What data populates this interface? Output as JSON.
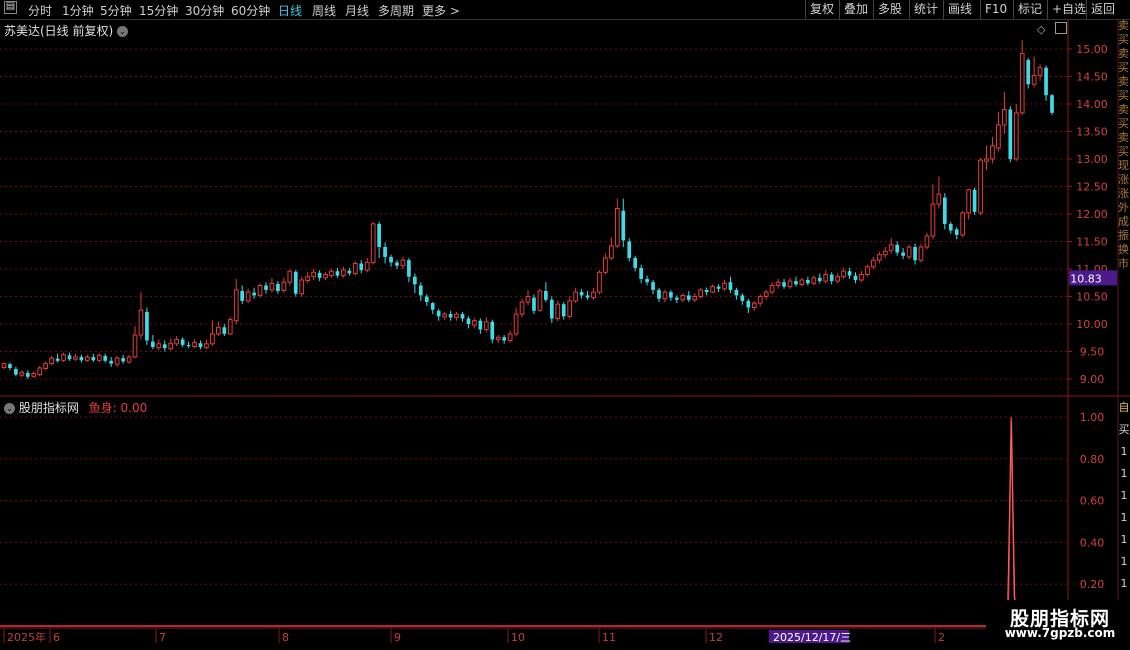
{
  "toolbar": {
    "left_items": [
      "分时",
      "1分钟",
      "5分钟",
      "15分钟",
      "30分钟",
      "60分钟",
      "日线",
      "周线",
      "月线",
      "多周期",
      "更多 >"
    ],
    "active_item": "日线",
    "right_items": [
      "复权",
      "叠加",
      "多股",
      "统计",
      "画线",
      "F10",
      "标记",
      "+自选",
      "返回"
    ]
  },
  "stock": {
    "title": "苏美达(日线 前复权)"
  },
  "price_axis": {
    "ticks": [
      "15.00",
      "14.50",
      "14.00",
      "13.50",
      "13.00",
      "12.50",
      "12.00",
      "11.50",
      "11.00",
      "10.50",
      "10.00",
      "9.50",
      "9.00"
    ],
    "current_label": "10.83"
  },
  "indicator": {
    "title": "股朋指标网",
    "value_label": "鱼身: 0.00",
    "ticks": [
      "1.00",
      "0.80",
      "0.60",
      "0.40",
      "0.20"
    ],
    "edge_marks": [
      "自",
      "买",
      "1",
      "1",
      "1",
      "1",
      "1",
      "1",
      "1",
      "1"
    ]
  },
  "date_axis": {
    "labels": [
      "2025年",
      "6",
      "7",
      "8",
      "9",
      "10",
      "11",
      "12",
      "2025/12/17/三",
      "2"
    ]
  },
  "right_panel_text": "卖买卖买卖买卖买卖买现涨涨外成振换市",
  "watermark": {
    "title": "股朋指标网",
    "url": "www.7gpzb.com"
  },
  "colors": {
    "up": "#e23c3c",
    "down": "#3cdce8",
    "grid": "#6a1010",
    "axis_bg_highlight": "#4b1a8c"
  },
  "chart_data": {
    "type": "candlestick",
    "ylim": [
      8.8,
      15.2
    ],
    "candles": [
      [
        9.21,
        9.28,
        9.3,
        9.18
      ],
      [
        9.27,
        9.2,
        9.3,
        9.16
      ],
      [
        9.18,
        9.08,
        9.22,
        9.05
      ],
      [
        9.07,
        9.12,
        9.16,
        9.03
      ],
      [
        9.11,
        9.04,
        9.16,
        9.0
      ],
      [
        9.05,
        9.1,
        9.14,
        9.02
      ],
      [
        9.08,
        9.2,
        9.24,
        9.05
      ],
      [
        9.19,
        9.28,
        9.32,
        9.16
      ],
      [
        9.28,
        9.38,
        9.42,
        9.25
      ],
      [
        9.37,
        9.33,
        9.46,
        9.3
      ],
      [
        9.34,
        9.44,
        9.48,
        9.31
      ],
      [
        9.43,
        9.36,
        9.48,
        9.33
      ],
      [
        9.36,
        9.4,
        9.46,
        9.33
      ],
      [
        9.4,
        9.34,
        9.44,
        9.3
      ],
      [
        9.34,
        9.4,
        9.44,
        9.31
      ],
      [
        9.4,
        9.34,
        9.46,
        9.31
      ],
      [
        9.34,
        9.43,
        9.47,
        9.31
      ],
      [
        9.42,
        9.33,
        9.46,
        9.3
      ],
      [
        9.33,
        9.28,
        9.4,
        9.22
      ],
      [
        9.27,
        9.38,
        9.42,
        9.22
      ],
      [
        9.38,
        9.32,
        9.44,
        9.28
      ],
      [
        9.31,
        9.4,
        9.44,
        9.28
      ],
      [
        9.4,
        9.8,
        9.96,
        9.38
      ],
      [
        9.8,
        10.25,
        10.58,
        9.72
      ],
      [
        10.22,
        9.7,
        10.3,
        9.62
      ],
      [
        9.68,
        9.58,
        9.8,
        9.54
      ],
      [
        9.57,
        9.64,
        9.72,
        9.52
      ],
      [
        9.63,
        9.56,
        9.7,
        9.5
      ],
      [
        9.55,
        9.65,
        9.74,
        9.52
      ],
      [
        9.64,
        9.72,
        9.78,
        9.6
      ],
      [
        9.72,
        9.62,
        9.76,
        9.58
      ],
      [
        9.62,
        9.6,
        9.68,
        9.56
      ],
      [
        9.59,
        9.66,
        9.72,
        9.56
      ],
      [
        9.65,
        9.58,
        9.7,
        9.54
      ],
      [
        9.57,
        9.64,
        9.72,
        9.54
      ],
      [
        9.64,
        9.82,
        10.06,
        9.6
      ],
      [
        9.82,
        9.94,
        10.05,
        9.78
      ],
      [
        9.94,
        9.82,
        10.0,
        9.78
      ],
      [
        9.82,
        10.08,
        10.12,
        9.8
      ],
      [
        10.06,
        10.62,
        10.82,
        10.0
      ],
      [
        10.6,
        10.42,
        10.7,
        10.36
      ],
      [
        10.42,
        10.58,
        10.64,
        10.38
      ],
      [
        10.57,
        10.52,
        10.66,
        10.46
      ],
      [
        10.52,
        10.7,
        10.74,
        10.48
      ],
      [
        10.7,
        10.62,
        10.76,
        10.55
      ],
      [
        10.62,
        10.74,
        10.84,
        10.58
      ],
      [
        10.73,
        10.6,
        10.78,
        10.55
      ],
      [
        10.61,
        10.76,
        10.84,
        10.57
      ],
      [
        10.76,
        10.96,
        10.99,
        10.7
      ],
      [
        10.95,
        10.55,
        10.98,
        10.5
      ],
      [
        10.55,
        10.8,
        10.86,
        10.5
      ],
      [
        10.79,
        10.86,
        10.94,
        10.74
      ],
      [
        10.86,
        10.94,
        11.0,
        10.8
      ],
      [
        10.93,
        10.84,
        10.98,
        10.78
      ],
      [
        10.84,
        10.9,
        10.94,
        10.8
      ],
      [
        10.88,
        10.96,
        11.0,
        10.84
      ],
      [
        10.96,
        10.88,
        11.02,
        10.84
      ],
      [
        10.88,
        10.98,
        11.04,
        10.84
      ],
      [
        10.97,
        10.92,
        11.02,
        10.88
      ],
      [
        10.92,
        11.1,
        11.14,
        10.88
      ],
      [
        11.1,
        10.98,
        11.16,
        10.92
      ],
      [
        10.98,
        11.12,
        11.2,
        10.94
      ],
      [
        11.12,
        11.82,
        11.86,
        11.08
      ],
      [
        11.82,
        11.4,
        11.86,
        11.2
      ],
      [
        11.4,
        11.22,
        11.48,
        11.1
      ],
      [
        11.22,
        11.12,
        11.26,
        11.04
      ],
      [
        11.12,
        11.06,
        11.16,
        11.0
      ],
      [
        11.06,
        11.16,
        11.22,
        11.0
      ],
      [
        11.16,
        10.86,
        11.2,
        10.76
      ],
      [
        10.86,
        10.72,
        10.92,
        10.56
      ],
      [
        10.7,
        10.52,
        10.76,
        10.42
      ],
      [
        10.5,
        10.4,
        10.54,
        10.33
      ],
      [
        10.38,
        10.26,
        10.4,
        10.18
      ],
      [
        10.24,
        10.14,
        10.28,
        10.06
      ],
      [
        10.13,
        10.18,
        10.22,
        10.08
      ],
      [
        10.18,
        10.12,
        10.24,
        10.06
      ],
      [
        10.12,
        10.18,
        10.22,
        10.06
      ],
      [
        10.18,
        10.1,
        10.22,
        10.04
      ],
      [
        10.1,
        10.0,
        10.14,
        9.92
      ],
      [
        9.98,
        10.06,
        10.1,
        9.92
      ],
      [
        10.06,
        9.9,
        10.1,
        9.82
      ],
      [
        9.9,
        10.04,
        10.12,
        9.85
      ],
      [
        10.04,
        9.72,
        10.08,
        9.65
      ],
      [
        9.72,
        9.76,
        9.8,
        9.65
      ],
      [
        9.76,
        9.7,
        9.8,
        9.64
      ],
      [
        9.7,
        9.82,
        9.88,
        9.66
      ],
      [
        9.82,
        10.18,
        10.3,
        9.78
      ],
      [
        10.18,
        10.4,
        10.46,
        10.12
      ],
      [
        10.4,
        10.5,
        10.62,
        10.34
      ],
      [
        10.48,
        10.24,
        10.54,
        10.18
      ],
      [
        10.25,
        10.6,
        10.64,
        10.22
      ],
      [
        10.6,
        10.44,
        10.76,
        10.4
      ],
      [
        10.44,
        10.1,
        10.5,
        10.02
      ],
      [
        10.1,
        10.36,
        10.42,
        10.05
      ],
      [
        10.36,
        10.14,
        10.4,
        10.08
      ],
      [
        10.14,
        10.42,
        10.5,
        10.1
      ],
      [
        10.42,
        10.58,
        10.66,
        10.38
      ],
      [
        10.58,
        10.52,
        10.64,
        10.46
      ],
      [
        10.52,
        10.48,
        10.6,
        10.44
      ],
      [
        10.48,
        10.58,
        10.66,
        10.44
      ],
      [
        10.58,
        10.94,
        10.98,
        10.54
      ],
      [
        10.94,
        11.2,
        11.28,
        10.9
      ],
      [
        11.2,
        11.42,
        11.58,
        11.16
      ],
      [
        11.42,
        12.1,
        12.28,
        11.38
      ],
      [
        12.06,
        11.52,
        12.28,
        11.4
      ],
      [
        11.5,
        11.2,
        11.56,
        11.14
      ],
      [
        11.2,
        11.02,
        11.24,
        10.96
      ],
      [
        11.02,
        10.82,
        11.08,
        10.74
      ],
      [
        10.82,
        10.76,
        10.88,
        10.7
      ],
      [
        10.76,
        10.62,
        10.8,
        10.54
      ],
      [
        10.62,
        10.46,
        10.66,
        10.4
      ],
      [
        10.46,
        10.58,
        10.62,
        10.4
      ],
      [
        10.58,
        10.48,
        10.62,
        10.42
      ],
      [
        10.48,
        10.44,
        10.52,
        10.38
      ],
      [
        10.44,
        10.52,
        10.56,
        10.4
      ],
      [
        10.52,
        10.44,
        10.6,
        10.4
      ],
      [
        10.44,
        10.5,
        10.56,
        10.4
      ],
      [
        10.5,
        10.62,
        10.66,
        10.46
      ],
      [
        10.62,
        10.58,
        10.66,
        10.52
      ],
      [
        10.58,
        10.68,
        10.72,
        10.56
      ],
      [
        10.68,
        10.64,
        10.72,
        10.58
      ],
      [
        10.64,
        10.74,
        10.8,
        10.6
      ],
      [
        10.76,
        10.62,
        10.86,
        10.56
      ],
      [
        10.62,
        10.52,
        10.66,
        10.44
      ],
      [
        10.52,
        10.42,
        10.56,
        10.35
      ],
      [
        10.42,
        10.3,
        10.46,
        10.2
      ],
      [
        10.3,
        10.38,
        10.42,
        10.24
      ],
      [
        10.38,
        10.5,
        10.54,
        10.32
      ],
      [
        10.5,
        10.58,
        10.62,
        10.44
      ],
      [
        10.58,
        10.7,
        10.76,
        10.54
      ],
      [
        10.7,
        10.76,
        10.82,
        10.64
      ],
      [
        10.76,
        10.68,
        10.82,
        10.64
      ],
      [
        10.68,
        10.78,
        10.84,
        10.64
      ],
      [
        10.78,
        10.72,
        10.86,
        10.68
      ],
      [
        10.72,
        10.8,
        10.84,
        10.68
      ],
      [
        10.8,
        10.74,
        10.86,
        10.7
      ],
      [
        10.74,
        10.84,
        10.88,
        10.7
      ],
      [
        10.84,
        10.78,
        10.92,
        10.74
      ],
      [
        10.78,
        10.9,
        10.98,
        10.74
      ],
      [
        10.9,
        10.78,
        10.94,
        10.72
      ],
      [
        10.78,
        10.86,
        10.92,
        10.74
      ],
      [
        10.86,
        10.96,
        11.02,
        10.82
      ],
      [
        10.96,
        10.88,
        11.02,
        10.82
      ],
      [
        10.88,
        10.8,
        10.94,
        10.74
      ],
      [
        10.8,
        10.9,
        10.96,
        10.76
      ],
      [
        10.9,
        11.04,
        11.08,
        10.86
      ],
      [
        11.04,
        11.16,
        11.22,
        11.0
      ],
      [
        11.16,
        11.26,
        11.32,
        11.1
      ],
      [
        11.26,
        11.32,
        11.4,
        11.2
      ],
      [
        11.34,
        11.44,
        11.56,
        11.28
      ],
      [
        11.44,
        11.3,
        11.5,
        11.24
      ],
      [
        11.3,
        11.24,
        11.38,
        11.18
      ],
      [
        11.22,
        11.4,
        11.44,
        11.18
      ],
      [
        11.4,
        11.16,
        11.46,
        11.08
      ],
      [
        11.16,
        11.4,
        11.46,
        11.12
      ],
      [
        11.4,
        11.6,
        11.66,
        11.36
      ],
      [
        11.6,
        12.18,
        12.54,
        11.54
      ],
      [
        12.18,
        12.36,
        12.68,
        12.1
      ],
      [
        12.3,
        11.82,
        12.38,
        11.72
      ],
      [
        11.82,
        11.7,
        11.86,
        11.64
      ],
      [
        11.72,
        11.62,
        11.76,
        11.54
      ],
      [
        11.62,
        12.02,
        12.06,
        11.58
      ],
      [
        12.02,
        12.44,
        12.46,
        11.9
      ],
      [
        12.44,
        12.04,
        12.48,
        11.98
      ],
      [
        12.02,
        12.98,
        13.02,
        11.98
      ],
      [
        12.96,
        13.0,
        13.24,
        12.8
      ],
      [
        13.0,
        13.24,
        13.4,
        12.92
      ],
      [
        13.2,
        13.62,
        13.86,
        13.14
      ],
      [
        13.62,
        13.9,
        14.22,
        13.46
      ],
      [
        13.9,
        13.0,
        13.96,
        12.94
      ],
      [
        13.0,
        13.84,
        14.0,
        12.96
      ],
      [
        13.84,
        14.92,
        15.16,
        13.8
      ],
      [
        14.8,
        14.36,
        14.84,
        14.28
      ],
      [
        14.36,
        14.52,
        14.86,
        14.3
      ],
      [
        14.52,
        14.66,
        14.72,
        14.42
      ],
      [
        14.66,
        14.16,
        14.7,
        14.06
      ],
      [
        14.16,
        13.84,
        14.18,
        13.8
      ]
    ],
    "indicator_series": {
      "name": "鱼身",
      "peak_index": 0.985,
      "peak_value": 1.0
    }
  }
}
